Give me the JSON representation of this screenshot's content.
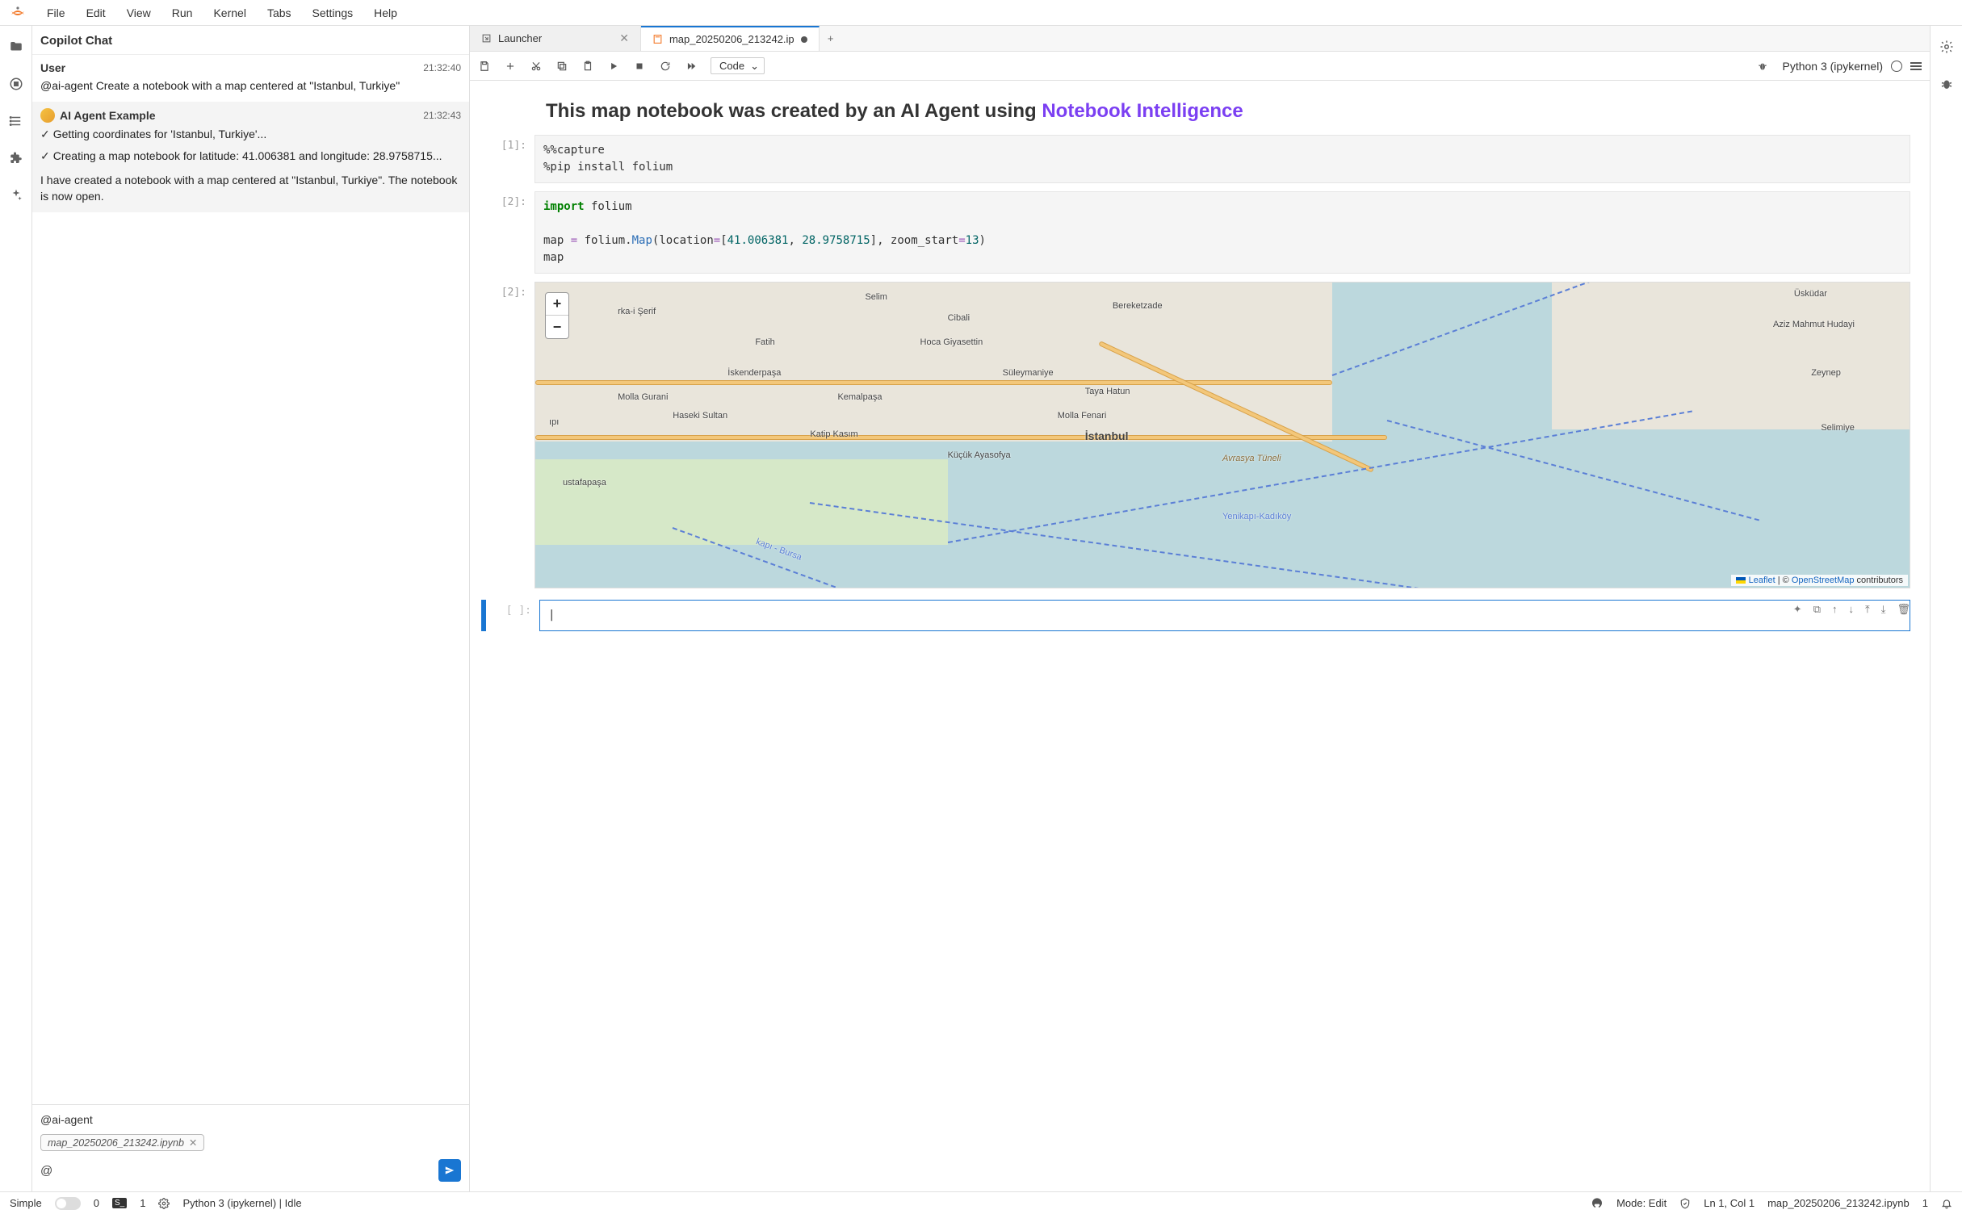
{
  "menu": {
    "file": "File",
    "edit": "Edit",
    "view": "View",
    "run": "Run",
    "kernel": "Kernel",
    "tabs": "Tabs",
    "settings": "Settings",
    "help": "Help"
  },
  "chat": {
    "title": "Copilot Chat",
    "user_label": "User",
    "user_time": "21:32:40",
    "user_body": "@ai-agent Create a notebook with a map centered at \"Istanbul, Turkiye\"",
    "agent_label": "AI Agent Example",
    "agent_time": "21:32:43",
    "step1": "Getting coordinates for 'Istanbul, Turkiye'...",
    "step2": "Creating a map notebook for latitude: 41.006381 and longitude: 28.9758715...",
    "agent_text": "I have created a notebook with a map centered at \"Istanbul, Turkiye\". The notebook is now open.",
    "input_prefill": "@ai-agent",
    "attachment": "map_20250206_213242.ipynb",
    "at_symbol": "@"
  },
  "tabs": {
    "launcher": "Launcher",
    "notebook": "map_20250206_213242.ip"
  },
  "toolbar": {
    "celltype": "Code",
    "kernel": "Python 3 (ipykernel)"
  },
  "notebook": {
    "md_line1": "This map notebook was created by an AI Agent using",
    "md_link": "Notebook Intelligence",
    "prompt1": "[1]:",
    "code1_l1": "%%capture",
    "code1_l2": "%pip install folium",
    "prompt2": "[2]:",
    "code2_import": "import",
    "code2_folium": " folium",
    "code2_line2_a": "map ",
    "code2_line2_op": "=",
    "code2_line2_b": " folium.",
    "code2_line2_map": "Map",
    "code2_line2_c": "(location",
    "code2_line2_eq": "=",
    "code2_line2_br": "[",
    "code2_line2_n1": "41.006381",
    "code2_line2_cm": ", ",
    "code2_line2_n2": "28.9758715",
    "code2_line2_br2": "]",
    "code2_line2_d": ", zoom_start",
    "code2_line2_eq2": "=",
    "code2_line2_n3": "13",
    "code2_line2_e": ")",
    "code2_line3": "map",
    "prompt_out": "[2]:",
    "prompt_empty": "[ ]:"
  },
  "map": {
    "labels": {
      "istanbul": "İstanbul",
      "uskudar": "Üsküdar",
      "selimiye": "Selimiye",
      "zeynep": "Zeynep",
      "azizmahmut": "Aziz Mahmut Hudayi",
      "fatih": "Fatih",
      "cibali": "Cibali",
      "selim": "Selim",
      "bereketzade": "Bereketzade",
      "hocagiya": "Hoca Giyasettin",
      "iskender": "İskenderpaşa",
      "suleym": "Süleymaniye",
      "tayahatun": "Taya Hatun",
      "kemalpasa": "Kemalpaşa",
      "mollafenari": "Molla Fenari",
      "mollagurani": "Molla Gurani",
      "haseki": "Haseki Sultan",
      "katip": "Katip Kasım",
      "kucuk": "Küçük Ayasofya",
      "karakaserif": "rka-i Şerif",
      "ustafapasa": "ustafapaşa",
      "api": "ıpı",
      "avrasya": "Avrasya Tüneli",
      "yenikapi": "Yenikapı-Kadıköy",
      "bursa": "kapı - Bursa"
    },
    "leaflet": "Leaflet",
    "osm": "OpenStreetMap",
    "contrib": " contributors",
    "sep": " | © "
  },
  "status": {
    "simple": "Simple",
    "zero": "0",
    "one": "1",
    "kernel": "Python 3 (ipykernel) | Idle",
    "mode": "Mode: Edit",
    "lncol": "Ln 1, Col 1",
    "file": "map_20250206_213242.ipynb",
    "n1": "1"
  }
}
